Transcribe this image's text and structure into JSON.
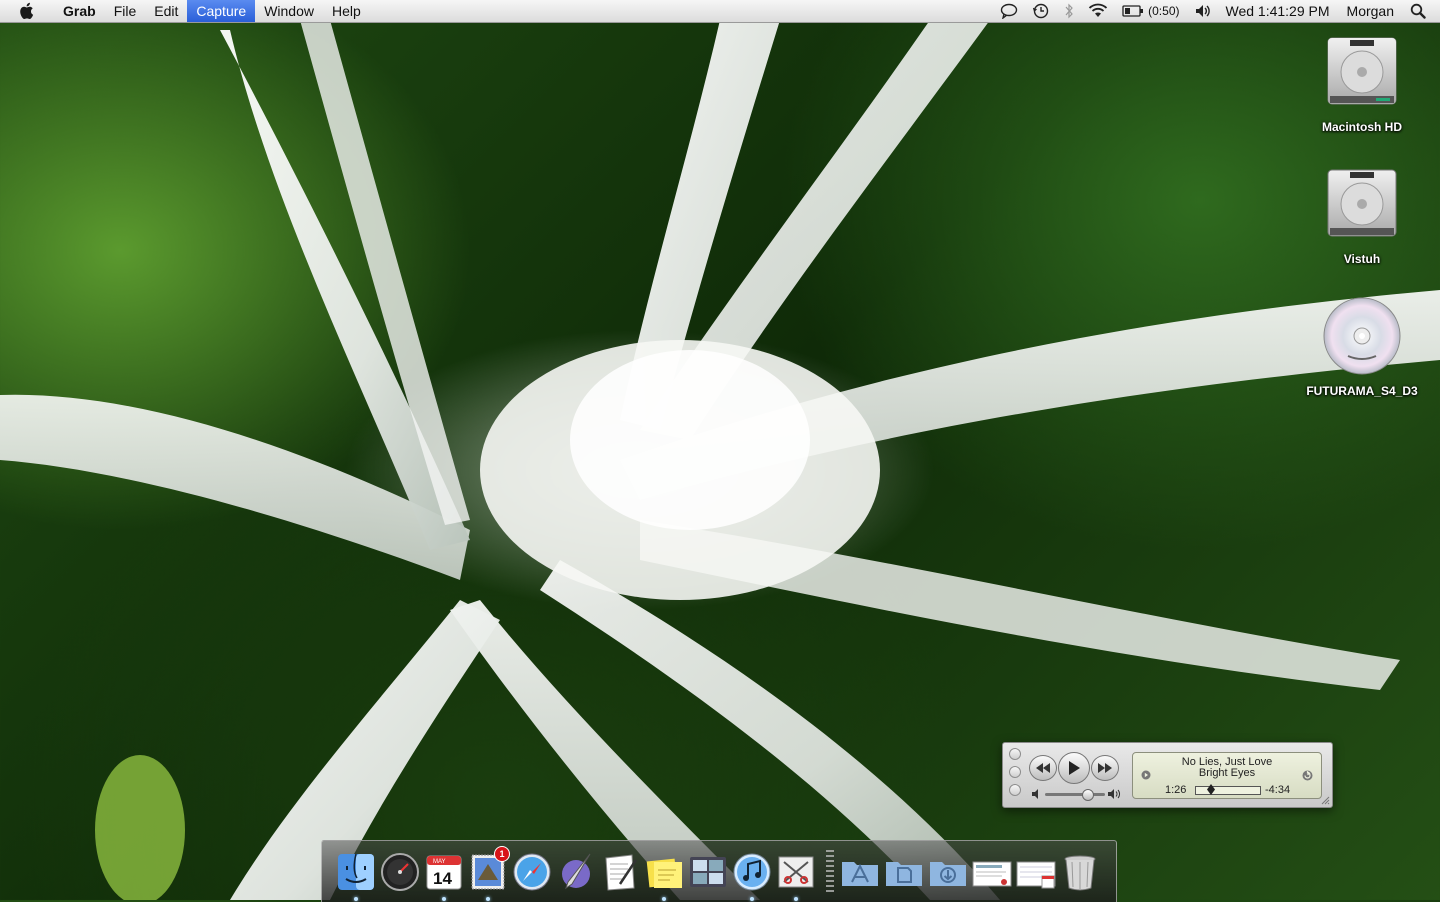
{
  "menubar": {
    "app_name": "Grab",
    "menus": [
      "File",
      "Edit",
      "Capture",
      "Window",
      "Help"
    ],
    "active_menu": "Capture",
    "battery": "(0:50)",
    "clock": "Wed 1:41:29 PM",
    "user": "Morgan"
  },
  "desktop": {
    "icons": [
      {
        "label": "Macintosh HD",
        "icon": "hard-drive-icon"
      },
      {
        "label": "Vistuh",
        "icon": "hard-drive-icon"
      },
      {
        "label": "FUTURAMA_S4_D3",
        "icon": "dvd-icon"
      }
    ]
  },
  "mini_player": {
    "song": "No Lies, Just Love",
    "artist": "Bright Eyes",
    "elapsed": "1:26",
    "remaining": "-4:34",
    "progress": 0.24,
    "volume": 0.7
  },
  "dock": {
    "items": [
      {
        "name": "finder",
        "running": true
      },
      {
        "name": "dashboard",
        "running": false
      },
      {
        "name": "ical",
        "running": true,
        "date_day": "14",
        "date_month": "MAY"
      },
      {
        "name": "mail",
        "running": true,
        "badge": "1"
      },
      {
        "name": "safari",
        "running": false
      },
      {
        "name": "script-editor",
        "running": false
      },
      {
        "name": "textedit",
        "running": false
      },
      {
        "name": "stickies",
        "running": true
      },
      {
        "name": "spaces",
        "running": false
      },
      {
        "name": "itunes",
        "running": true
      },
      {
        "name": "grab",
        "running": true
      }
    ],
    "stacks": [
      "applications-folder",
      "documents-folder",
      "downloads-folder",
      "mail-stack",
      "ical-stack"
    ],
    "trash": "trash"
  }
}
